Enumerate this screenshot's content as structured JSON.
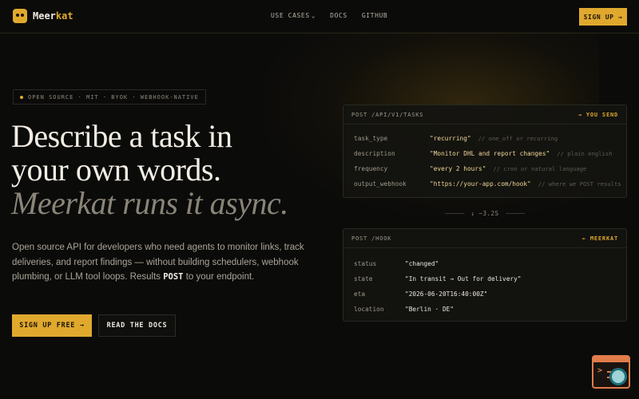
{
  "nav": {
    "brand_prefix": "Meer",
    "brand_suffix": "kat",
    "links": [
      "USE CASES",
      "DOCS",
      "GITHUB"
    ],
    "cta": "SIGN UP →"
  },
  "hero": {
    "pill": "OPEN SOURCE · MIT · BYOK · WEBHOOK-NATIVE",
    "title_line1": "Describe a task in",
    "title_line2": "your own words.",
    "title_line3": "Meerkat runs it async.",
    "lede_before": "Open source API for developers who need agents to monitor links, track deliveries, and report findings — without building schedulers, webhook plumbing, or LLM tool loops. Results ",
    "lede_bold": "POST",
    "lede_after": " to your endpoint.",
    "primary_button": "SIGN UP FREE →",
    "secondary_button": "READ THE DOCS"
  },
  "request_panel": {
    "title": "POST /API/V1/TASKS",
    "tag": "→ YOU SEND",
    "rows": [
      {
        "key": "task_type",
        "value": "\"recurring\"",
        "comment": "// one_off or recurring"
      },
      {
        "key": "description",
        "value": "\"Monitor DHL and report changes\"",
        "comment": "// plain english"
      },
      {
        "key": "frequency",
        "value": "\"every 2 hours\"",
        "comment": "// cron or natural language"
      },
      {
        "key": "output_webhook",
        "value": "\"https://your-app.com/hook\"",
        "comment": "// where we POST results"
      }
    ]
  },
  "connector": "↓ ~3.2S",
  "response_panel": {
    "title": "POST /HOOK",
    "tag": "← MEERKAT",
    "rows": [
      {
        "key": "status",
        "value": "\"changed\""
      },
      {
        "key": "state",
        "value": "\"In transit → Out for delivery\""
      },
      {
        "key": "eta",
        "value": "\"2026-06-20T16:40:00Z\""
      },
      {
        "key": "location",
        "value": "\"Berlin · DE\""
      }
    ]
  },
  "icons": {
    "logo": "meerkat-logo-icon",
    "widget": "terminal-search-icon"
  },
  "colors": {
    "accent": "#e0a92e",
    "background": "#0b0b0a"
  }
}
